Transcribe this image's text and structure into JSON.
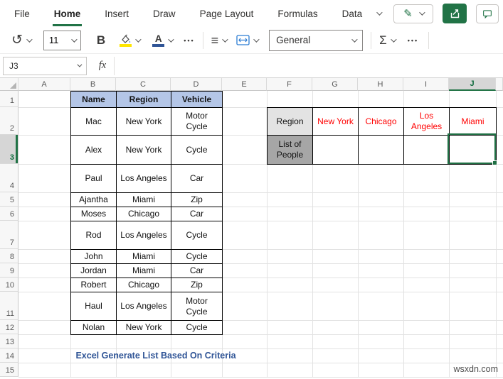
{
  "ribbon": {
    "tabs": [
      "File",
      "Home",
      "Insert",
      "Draw",
      "Page Layout",
      "Formulas",
      "Data"
    ],
    "active_tab": "Home"
  },
  "toolbar": {
    "font_size": "11",
    "number_format": "General"
  },
  "formula_bar": {
    "cell_reference": "J3",
    "formula_value": ""
  },
  "icons": {
    "undo": "↺",
    "bold": "B",
    "font_color": "A",
    "align": "≡",
    "sum": "Σ",
    "more": "•••",
    "fx": "fx",
    "pencil": "✎"
  },
  "sheet": {
    "column_headers": [
      "A",
      "B",
      "C",
      "D",
      "E",
      "F",
      "G",
      "H",
      "I",
      "J"
    ],
    "row_headers": [
      "1",
      "2",
      "3",
      "4",
      "5",
      "6",
      "7",
      "8",
      "9",
      "10",
      "11",
      "12",
      "13",
      "14",
      "15"
    ],
    "selected_cell": "J3",
    "selected_column": "J",
    "selected_row": "3"
  },
  "people_table": {
    "headers": [
      "Name",
      "Region",
      "Vehicle"
    ],
    "rows": [
      [
        "Mac",
        "New York",
        "Motor Cycle"
      ],
      [
        "Alex",
        "New York",
        "Cycle"
      ],
      [
        "Paul",
        "Los Angeles",
        "Car"
      ],
      [
        "Ajantha",
        "Miami",
        "Zip"
      ],
      [
        "Moses",
        "Chicago",
        "Car"
      ],
      [
        "Rod",
        "Los Angeles",
        "Cycle"
      ],
      [
        "John",
        "Miami",
        "Cycle"
      ],
      [
        "Jordan",
        "Miami",
        "Car"
      ],
      [
        "Robert",
        "Chicago",
        "Zip"
      ],
      [
        "Haul",
        "Los Angeles",
        "Motor Cycle"
      ],
      [
        "Nolan",
        "New York",
        "Cycle"
      ]
    ]
  },
  "criteria_table": {
    "region_label": "Region",
    "list_label": "List of People",
    "regions": [
      "New York",
      "Chicago",
      "Los Angeles",
      "Miami"
    ],
    "list_values": [
      "",
      "",
      "",
      ""
    ]
  },
  "caption": "Excel Generate List Based On Criteria",
  "watermark": "wsxdn.com",
  "colors": {
    "excel_green": "#217346",
    "header_fill_blue": "#B4C6E7",
    "criteria_text_red": "#FF0000",
    "caption_blue": "#2F5496",
    "region_fill_gray": "#E3E3E3",
    "list_fill_gray": "#A6A6A6"
  }
}
